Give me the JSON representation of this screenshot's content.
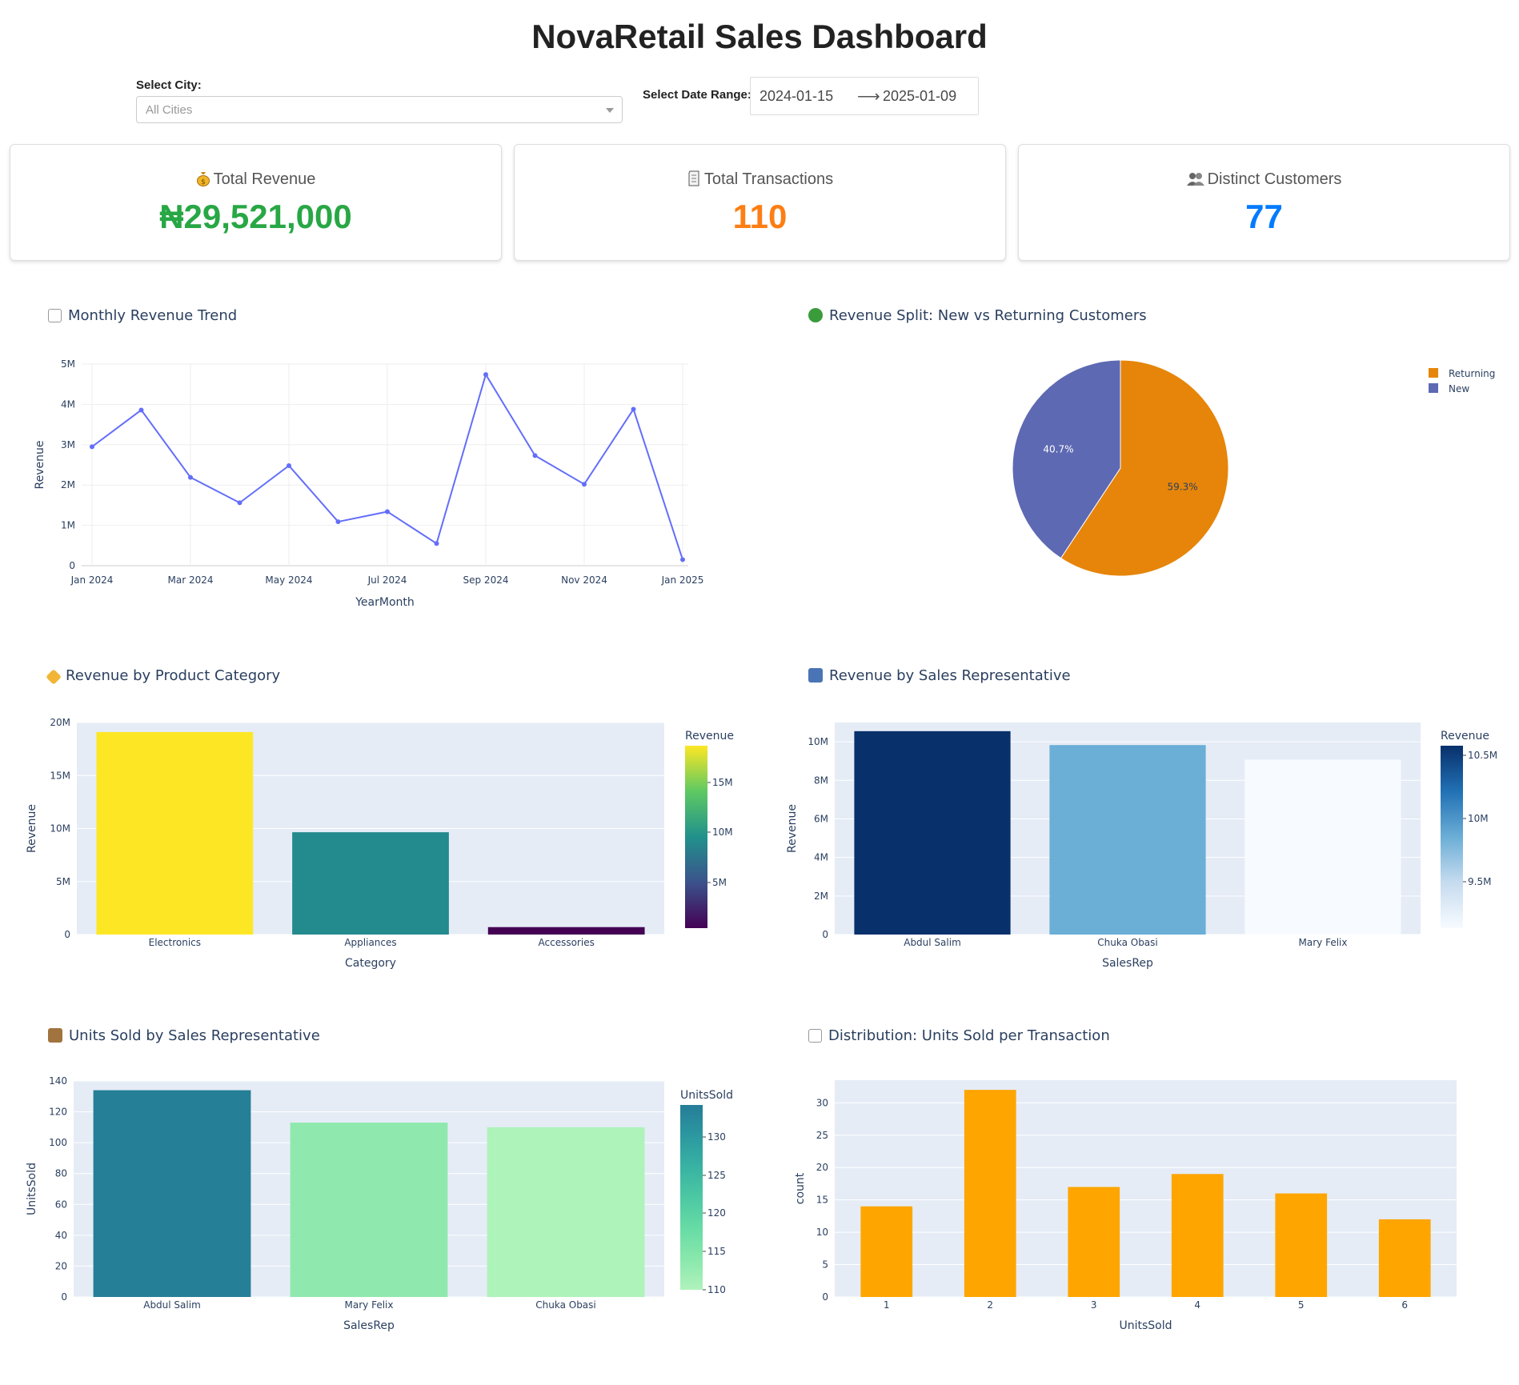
{
  "header": {
    "title": "NovaRetail Sales Dashboard"
  },
  "filters": {
    "city_label": "Select City:",
    "city_placeholder": "All Cities",
    "date_label": "Select Date Range:",
    "date_start": "2024-01-15",
    "date_end": "2025-01-09"
  },
  "kpis": [
    {
      "label": "Total Revenue",
      "value": "₦29,521,000",
      "color": "#28a745",
      "icon": "money-bag-icon"
    },
    {
      "label": "Total Transactions",
      "value": "110",
      "color": "#fd7e14",
      "icon": "receipt-icon"
    },
    {
      "label": "Distinct Customers",
      "value": "77",
      "color": "#007bff",
      "icon": "people-icon"
    }
  ],
  "charts": {
    "trend_title": "Monthly Revenue Trend",
    "split_title": "Revenue Split: New vs Returning Customers",
    "category_title": "Revenue by Product Category",
    "salesrep_title": "Revenue by Sales Representative",
    "units_title": "Units Sold by Sales Representative",
    "dist_title": "Distribution: Units Sold per Transaction"
  },
  "chart_data": [
    {
      "type": "line",
      "x": [
        "2024-01",
        "2024-02",
        "2024-03",
        "2024-04",
        "2024-05",
        "2024-06",
        "2024-07",
        "2024-08",
        "2024-09",
        "2024-10",
        "2024-11",
        "2024-12",
        "2025-01"
      ],
      "values": [
        2950000,
        3860000,
        2190000,
        1560000,
        2480000,
        1090000,
        1340000,
        550000,
        4740000,
        2730000,
        2020000,
        3880000,
        150000
      ],
      "x_ticks": [
        "Jan 2024",
        "Mar 2024",
        "May 2024",
        "Jul 2024",
        "Sep 2024",
        "Nov 2024",
        "Jan 2025"
      ],
      "y_ticks": [
        "0",
        "1M",
        "2M",
        "3M",
        "4M",
        "5M"
      ],
      "xlabel": "YearMonth",
      "ylabel": "Revenue",
      "ylim": [
        0,
        5000000
      ],
      "line_color": "#636efa",
      "grid": true
    },
    {
      "type": "pie",
      "labels": [
        "Returning",
        "New"
      ],
      "values": [
        59.3,
        40.7
      ],
      "slice_labels": [
        "59.3%",
        "40.7%"
      ],
      "colors": [
        "#e6850a",
        "#5e69b3"
      ],
      "legend": "top-right"
    },
    {
      "type": "bar",
      "categories": [
        "Electronics",
        "Appliances",
        "Accessories"
      ],
      "values": [
        19100000,
        9650000,
        700000
      ],
      "y_ticks": [
        "0",
        "5M",
        "10M",
        "15M",
        "20M"
      ],
      "xlabel": "Category",
      "ylabel": "Revenue",
      "ylim": [
        0,
        20000000
      ],
      "colorbar_title": "Revenue",
      "colorbar_ticks": [
        "5M",
        "10M",
        "15M"
      ],
      "colors": [
        "#fde725",
        "#238a8d",
        "#440154"
      ],
      "colorbar_gradient": [
        "#440154",
        "#3b528b",
        "#21918c",
        "#5ec962",
        "#fde725"
      ]
    },
    {
      "type": "bar",
      "categories": [
        "Abdul Salim",
        "Chuka Obasi",
        "Mary Felix"
      ],
      "values": [
        10550000,
        9830000,
        9070000
      ],
      "y_ticks": [
        "0",
        "2M",
        "4M",
        "6M",
        "8M",
        "10M"
      ],
      "xlabel": "SalesRep",
      "ylabel": "Revenue",
      "ylim": [
        0,
        11000000
      ],
      "colorbar_title": "Revenue",
      "colorbar_ticks": [
        "9.5M",
        "10M",
        "10.5M"
      ],
      "colors": [
        "#08306b",
        "#6baed6",
        "#f7fbff"
      ],
      "colorbar_gradient": [
        "#f7fbff",
        "#c6dbef",
        "#6baed6",
        "#2171b5",
        "#08306b"
      ]
    },
    {
      "type": "bar",
      "categories": [
        "Abdul Salim",
        "Mary Felix",
        "Chuka Obasi"
      ],
      "values": [
        134,
        113,
        110
      ],
      "y_ticks": [
        "0",
        "20",
        "40",
        "60",
        "80",
        "100",
        "120",
        "140"
      ],
      "xlabel": "SalesRep",
      "ylabel": "UnitsSold",
      "ylim": [
        0,
        140
      ],
      "colorbar_title": "UnitsSold",
      "colorbar_ticks": [
        "110",
        "115",
        "120",
        "125",
        "130"
      ],
      "colors": [
        "#257f97",
        "#8fe9ae",
        "#adf3ba"
      ],
      "colorbar_gradient": [
        "#b0f2bc",
        "#89e8ac",
        "#67dba5",
        "#4cc8a3",
        "#38b2a3",
        "#2c98a0",
        "#257d98"
      ]
    },
    {
      "type": "bar",
      "categories": [
        "1",
        "2",
        "3",
        "4",
        "5",
        "6"
      ],
      "values": [
        14,
        32,
        17,
        19,
        16,
        12
      ],
      "y_ticks": [
        "0",
        "5",
        "10",
        "15",
        "20",
        "25",
        "30"
      ],
      "xlabel": "UnitsSold",
      "ylabel": "count",
      "ylim": [
        0,
        33.5
      ],
      "colors": [
        "#ffa500"
      ]
    }
  ]
}
